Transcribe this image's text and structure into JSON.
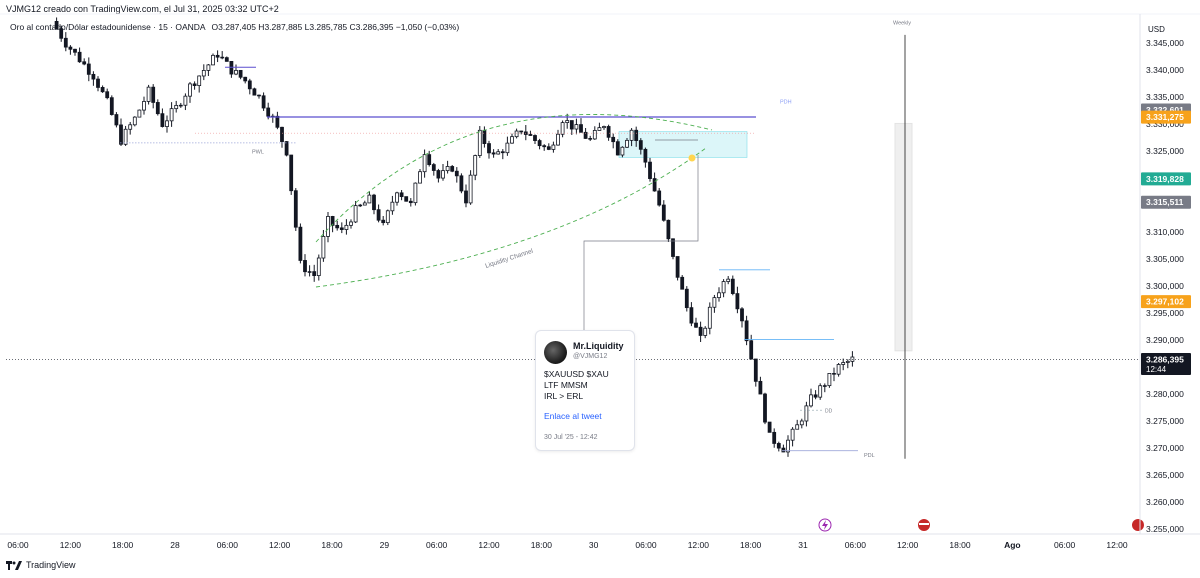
{
  "header": {
    "watermark": "VJMG12 creado con TradingView.com, el Jul 31, 2025 03:32 UTC+2",
    "symbol": "Oro al contado/Dólar estadounidense · 15 · OANDA",
    "ohlc": "O3.287,405  H3.287,885  L3.285,785  C3.286,395  −1,050 (−0,03%)"
  },
  "footer": {
    "brand": "TradingView"
  },
  "colors": {
    "up": "#26a69a",
    "down": "#ef5350",
    "candle": "#131722",
    "pdh": "#5b4fcf",
    "channel": "#4caf50",
    "zone": "#b2ebf2",
    "gray_label": "#787b86",
    "orange": "#f7a21b",
    "teal": "#22ab94"
  },
  "tweet": {
    "name": "Mr.Liquidity",
    "handle": "@VJMG12",
    "lines": [
      "$XAUUSD $XAU",
      "LTF MMSM",
      "IRL > ERL"
    ],
    "link": "Enlace al tweet",
    "date": "30 Jul '25 - 12:42"
  },
  "annotations": {
    "pwl": "PWL",
    "pdh": "PDH",
    "pdl": "PDL",
    "weekly": "Weekly",
    "dd": "DD",
    "channel": "Liquidity Channel"
  },
  "chart_data": {
    "type": "candlestick",
    "currency": "USD",
    "ylim": [
      3255,
      3350
    ],
    "y_ticks": [
      3255,
      3260,
      3265,
      3270,
      3275,
      3280,
      3285,
      3290,
      3295,
      3300,
      3305,
      3310,
      3315,
      3320,
      3325,
      3330,
      3335,
      3340,
      3345
    ],
    "y_tick_labels": [
      "3.255,000",
      "3.260,000",
      "3.265,000",
      "3.270,000",
      "3.275,000",
      "3.280,000",
      "3.285,000",
      "3.290,000",
      "3.295,000",
      "3.300,000",
      "3.305,000",
      "3.310,000",
      "3.315,000",
      "3.320,000",
      "3.325,000",
      "3.330,000",
      "3.335,000",
      "3.340,000",
      "3.345,000"
    ],
    "x_labels": [
      "06:00",
      "12:00",
      "18:00",
      "28",
      "06:00",
      "12:00",
      "18:00",
      "29",
      "06:00",
      "12:00",
      "18:00",
      "30",
      "06:00",
      "12:00",
      "18:00",
      "31",
      "06:00",
      "12:00",
      "18:00",
      "Ago",
      "06:00",
      "12:00"
    ],
    "x_label_bold": [
      "Ago"
    ],
    "price_path": [
      [
        0,
        3349
      ],
      [
        3,
        3345
      ],
      [
        6,
        3342
      ],
      [
        9,
        3339
      ],
      [
        12,
        3334
      ],
      [
        15,
        3327
      ],
      [
        18,
        3331
      ],
      [
        21,
        3336
      ],
      [
        24,
        3330
      ],
      [
        27,
        3333
      ],
      [
        30,
        3337
      ],
      [
        33,
        3340
      ],
      [
        36,
        3343
      ],
      [
        39,
        3340
      ],
      [
        42,
        3338
      ],
      [
        45,
        3335
      ],
      [
        48,
        3331
      ],
      [
        51,
        3325
      ],
      [
        54,
        3304
      ],
      [
        57,
        3302
      ],
      [
        60,
        3312
      ],
      [
        63,
        3310
      ],
      [
        66,
        3314
      ],
      [
        69,
        3316
      ],
      [
        72,
        3311
      ],
      [
        75,
        3318
      ],
      [
        78,
        3315
      ],
      [
        81,
        3325
      ],
      [
        84,
        3320
      ],
      [
        87,
        3322
      ],
      [
        90,
        3316
      ],
      [
        93,
        3328
      ],
      [
        96,
        3324
      ],
      [
        99,
        3326
      ],
      [
        102,
        3329
      ],
      [
        105,
        3327
      ],
      [
        108,
        3325
      ],
      [
        111,
        3331
      ],
      [
        114,
        3329
      ],
      [
        117,
        3327
      ],
      [
        120,
        3330
      ],
      [
        123,
        3325
      ],
      [
        126,
        3329
      ],
      [
        129,
        3323
      ],
      [
        132,
        3315
      ],
      [
        135,
        3305
      ],
      [
        138,
        3296
      ],
      [
        141,
        3290
      ],
      [
        144,
        3298
      ],
      [
        147,
        3302
      ],
      [
        150,
        3294
      ],
      [
        153,
        3283
      ],
      [
        156,
        3272
      ],
      [
        159,
        3270
      ],
      [
        162,
        3274
      ],
      [
        165,
        3279
      ],
      [
        168,
        3282
      ],
      [
        171,
        3285
      ],
      [
        174,
        3286.4
      ]
    ],
    "last_price": 3286.395,
    "price_labels": [
      {
        "value": 3332.601,
        "text": "3.332,601",
        "color": "#787b86"
      },
      {
        "value": 3331.275,
        "text": "3.331,275",
        "color": "#f7a21b"
      },
      {
        "value": 3319.828,
        "text": "3.319,828",
        "color": "#22ab94"
      },
      {
        "value": 3315.511,
        "text": "3.315,511",
        "color": "#787b86"
      },
      {
        "value": 3297.102,
        "text": "3.297,102",
        "color": "#f7a21b"
      },
      {
        "value": 3286.395,
        "text": "3.286,395",
        "sub": "12:44",
        "color": "#131722"
      }
    ],
    "levels": {
      "pdh": 3331.3,
      "pwl": 3326.5,
      "pdl": 3269.5,
      "weekly_top": 3346.5,
      "weekly_bottom": 3268
    }
  }
}
